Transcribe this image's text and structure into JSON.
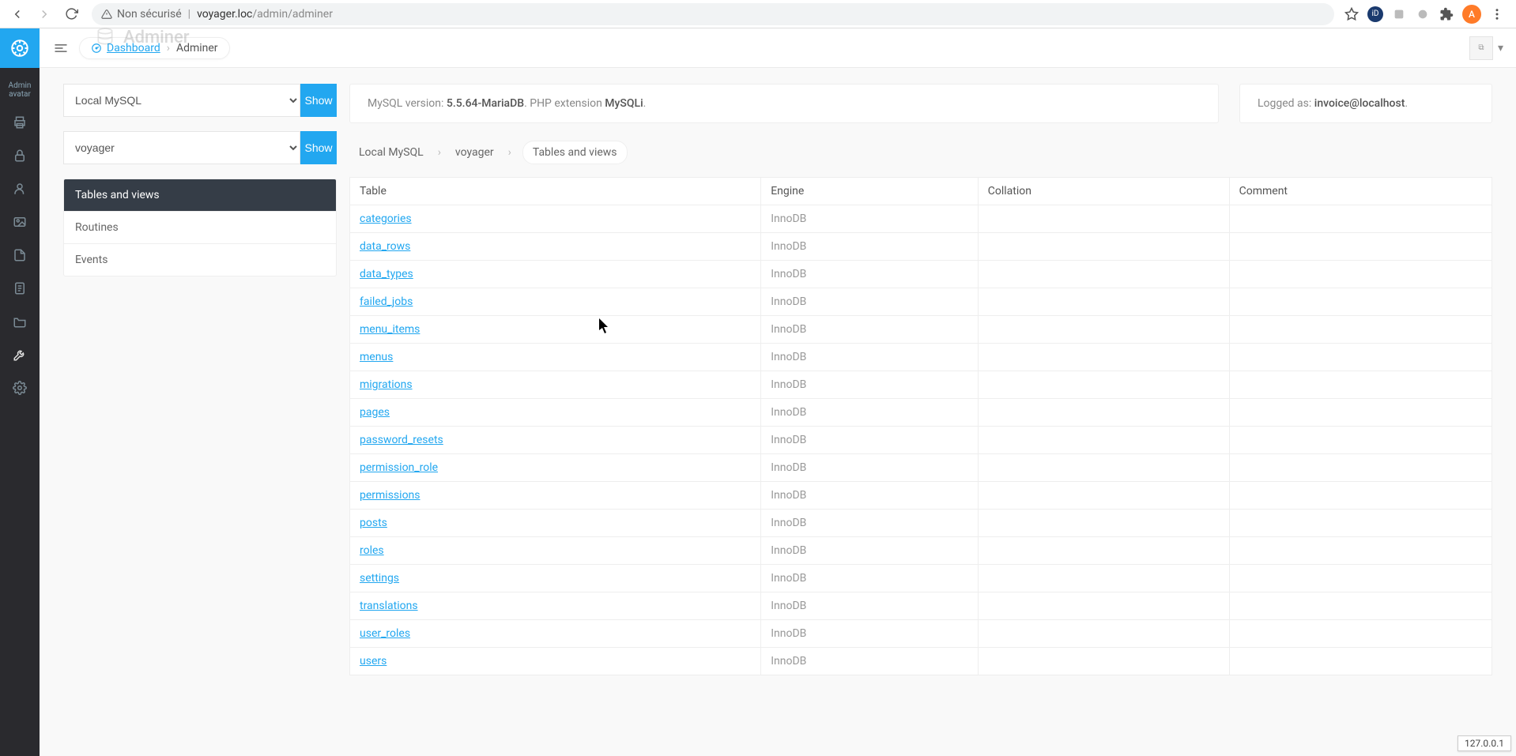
{
  "browser": {
    "security_label": "Non sécurisé",
    "url_domain": "voyager.loc",
    "url_path": "/admin/adminer",
    "avatar_letter": "A"
  },
  "iconbar": {
    "avatar_alt": "Admin avatar"
  },
  "topbar": {
    "page_title": "Adminer",
    "dashboard_label": "Dashboard",
    "current": "Adminer"
  },
  "user_box": {
    "alt": "⧉"
  },
  "left": {
    "server_select": "Local MySQL",
    "db_select": "voyager",
    "show_label": "Show",
    "nav": {
      "tables": "Tables and views",
      "routines": "Routines",
      "events": "Events"
    }
  },
  "info": {
    "version_label": "MySQL version: ",
    "version_value": "5.5.64-MariaDB",
    "ext_label": ". PHP extension ",
    "ext_value": "MySQLi",
    "ext_tail": ".",
    "logged_label": "Logged as: ",
    "logged_value": "invoice@localhost",
    "logged_tail": "."
  },
  "crumbs": {
    "server": "Local MySQL",
    "db": "voyager",
    "section": "Tables and views"
  },
  "table": {
    "headers": {
      "table": "Table",
      "engine": "Engine",
      "collation": "Collation",
      "comment": "Comment"
    },
    "rows": [
      {
        "name": "categories",
        "engine": "InnoDB",
        "collation": "",
        "comment": ""
      },
      {
        "name": "data_rows",
        "engine": "InnoDB",
        "collation": "",
        "comment": ""
      },
      {
        "name": "data_types",
        "engine": "InnoDB",
        "collation": "",
        "comment": ""
      },
      {
        "name": "failed_jobs",
        "engine": "InnoDB",
        "collation": "",
        "comment": ""
      },
      {
        "name": "menu_items",
        "engine": "InnoDB",
        "collation": "",
        "comment": ""
      },
      {
        "name": "menus",
        "engine": "InnoDB",
        "collation": "",
        "comment": ""
      },
      {
        "name": "migrations",
        "engine": "InnoDB",
        "collation": "",
        "comment": ""
      },
      {
        "name": "pages",
        "engine": "InnoDB",
        "collation": "",
        "comment": ""
      },
      {
        "name": "password_resets",
        "engine": "InnoDB",
        "collation": "",
        "comment": ""
      },
      {
        "name": "permission_role",
        "engine": "InnoDB",
        "collation": "",
        "comment": ""
      },
      {
        "name": "permissions",
        "engine": "InnoDB",
        "collation": "",
        "comment": ""
      },
      {
        "name": "posts",
        "engine": "InnoDB",
        "collation": "",
        "comment": ""
      },
      {
        "name": "roles",
        "engine": "InnoDB",
        "collation": "",
        "comment": ""
      },
      {
        "name": "settings",
        "engine": "InnoDB",
        "collation": "",
        "comment": ""
      },
      {
        "name": "translations",
        "engine": "InnoDB",
        "collation": "",
        "comment": ""
      },
      {
        "name": "user_roles",
        "engine": "InnoDB",
        "collation": "",
        "comment": ""
      },
      {
        "name": "users",
        "engine": "InnoDB",
        "collation": "",
        "comment": ""
      }
    ]
  },
  "status_ip": "127.0.0.1"
}
